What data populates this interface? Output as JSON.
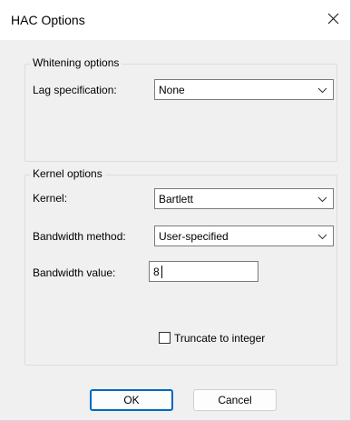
{
  "dialog": {
    "title": "HAC Options"
  },
  "whitening": {
    "legend": "Whitening options",
    "lag_label": "Lag specification:",
    "lag_value": "None"
  },
  "kernel": {
    "legend": "Kernel options",
    "kernel_label": "Kernel:",
    "kernel_value": "Bartlett",
    "bandwidth_method_label": "Bandwidth method:",
    "bandwidth_method_value": "User-specified",
    "bandwidth_value_label": "Bandwidth value:",
    "bandwidth_value": "8",
    "truncate_label": "Truncate to integer",
    "truncate_checked": false
  },
  "buttons": {
    "ok": "OK",
    "cancel": "Cancel"
  },
  "icons": {
    "close": "close-icon",
    "dropdown": "chevron-down-icon"
  },
  "colors": {
    "default_button_border": "#0067c0",
    "dialog_background": "#f0f0f0"
  }
}
